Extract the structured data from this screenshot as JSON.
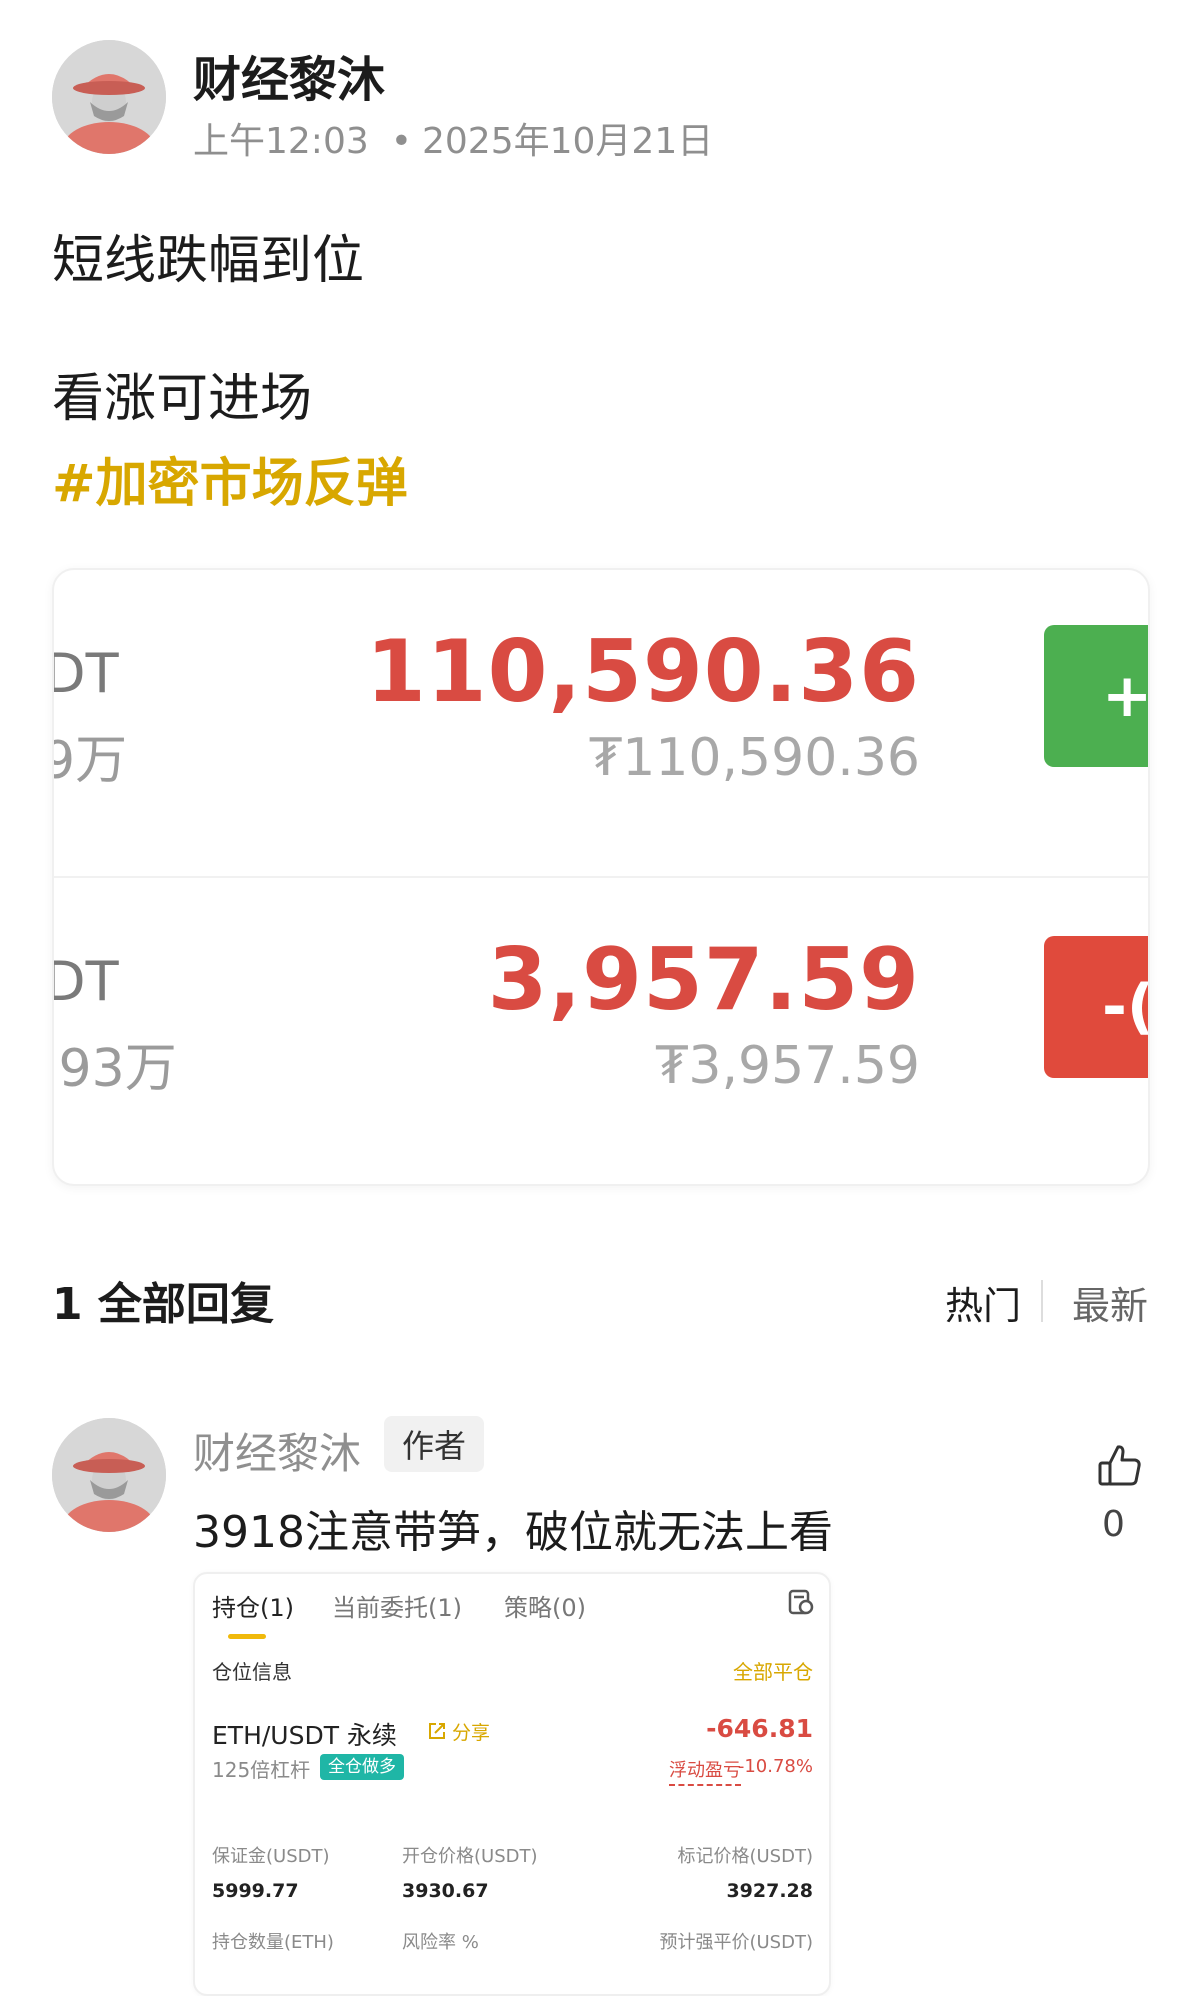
{
  "post": {
    "author_name": "财经黎沐",
    "time": "上午12:03",
    "separator": "•",
    "date": "2025年10月21日",
    "line1": "短线跌幅到位",
    "line2": "看涨可进场",
    "hashtag": "#加密市场反弹"
  },
  "ticker_card": {
    "rows": [
      {
        "symbol_partial": "DT",
        "volume_partial": "9万",
        "price": "110,590.36",
        "price_cny": "₮110,590.36",
        "change_partial": "+",
        "direction": "up"
      },
      {
        "symbol_partial": "DT",
        "volume_partial": ".93万",
        "price": "3,957.59",
        "price_cny": "₮3,957.59",
        "change_partial": "-(",
        "direction": "down"
      }
    ],
    "colors": {
      "up": "#4caf50",
      "down": "#e04a3c",
      "price": "#d94b42"
    }
  },
  "replies": {
    "count_label": "1 全部回复",
    "sort_hot": "热门",
    "sort_new": "最新"
  },
  "reply": {
    "author_name": "财经黎沐",
    "author_badge": "作者",
    "text": "3918注意带笋，破位就无法上看",
    "like_count": "0",
    "like_icon": "thumbs-up-icon"
  },
  "position_card": {
    "tabs": [
      "持仓(1)",
      "当前委托(1)",
      "策略(0)"
    ],
    "section_title": "仓位信息",
    "close_all": "全部平仓",
    "pair": "ETH/USDT 永续",
    "share": "分享",
    "pnl": "-646.81",
    "leverage": "125倍杠杆",
    "mode": "全仓做多",
    "float_label": "浮动盈亏",
    "float_pct": "-10.78%",
    "fields_row1": [
      {
        "label": "保证金(USDT)",
        "value": "5999.77"
      },
      {
        "label": "开仓价格(USDT)",
        "value": "3930.67"
      },
      {
        "label": "标记价格(USDT)",
        "value": "3927.28"
      }
    ],
    "fields_row2": [
      {
        "label": "持仓数量(ETH)",
        "value": ""
      },
      {
        "label": "风险率 %",
        "value": ""
      },
      {
        "label": "预计强平价(USDT)",
        "value": ""
      }
    ],
    "accent": "#f0b90b"
  }
}
